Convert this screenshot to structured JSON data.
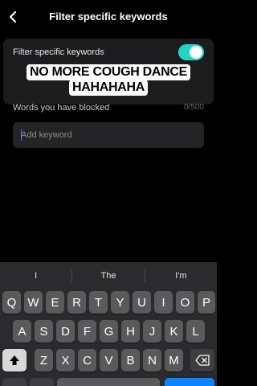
{
  "header": {
    "title": "Filter specific keywords"
  },
  "filter": {
    "toggle_label": "Filter specific keywords",
    "toggle_on": true,
    "accent_color": "#20d5c4"
  },
  "caption": {
    "line1": "NO MORE COUGH DANCE",
    "line2": "HAHAHAHA"
  },
  "blocked": {
    "label": "Words you have blocked",
    "count": "0/500"
  },
  "input": {
    "placeholder": "Add keyword",
    "value": ""
  },
  "keyboard": {
    "suggestions": [
      "I",
      "The",
      "I'm"
    ],
    "row1": [
      "Q",
      "W",
      "E",
      "R",
      "T",
      "Y",
      "U",
      "I",
      "O",
      "P"
    ],
    "row2": [
      "A",
      "S",
      "D",
      "F",
      "G",
      "H",
      "J",
      "K",
      "L"
    ],
    "row3": [
      "Z",
      "X",
      "C",
      "V",
      "B",
      "N",
      "M"
    ]
  }
}
